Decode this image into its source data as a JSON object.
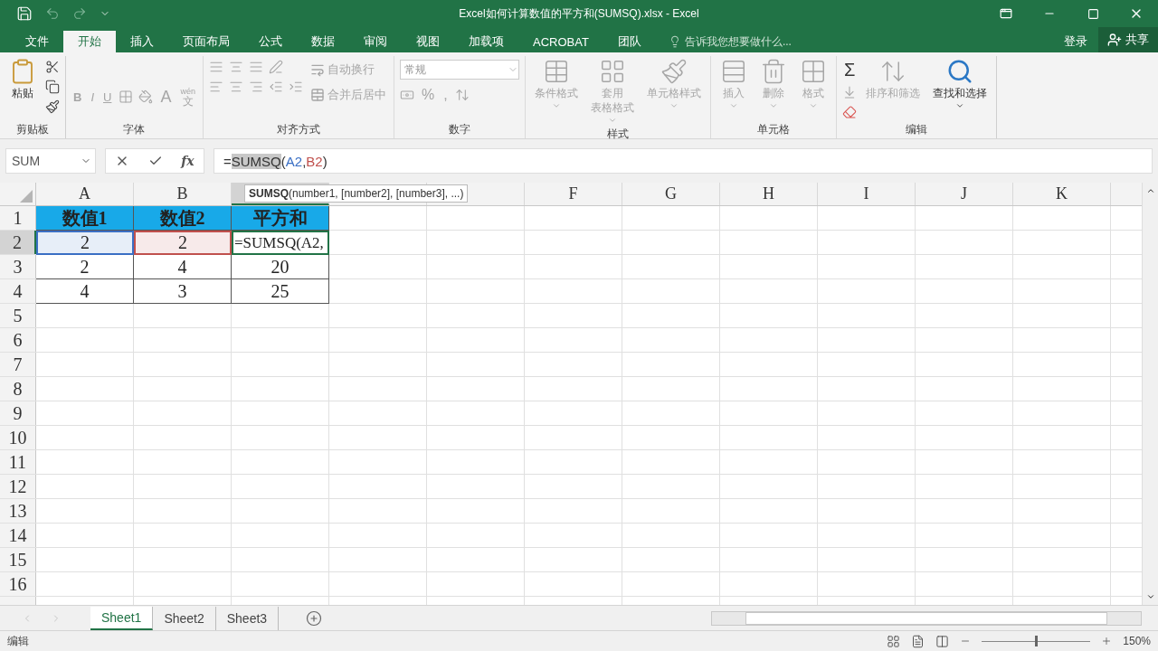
{
  "window": {
    "title": "Excel如何计算数值的平方和(SUMSQ).xlsx - Excel"
  },
  "tabs": [
    {
      "label": "文件",
      "selected": false
    },
    {
      "label": "开始",
      "selected": true
    },
    {
      "label": "插入",
      "selected": false
    },
    {
      "label": "页面布局",
      "selected": false
    },
    {
      "label": "公式",
      "selected": false
    },
    {
      "label": "数据",
      "selected": false
    },
    {
      "label": "审阅",
      "selected": false
    },
    {
      "label": "视图",
      "selected": false
    },
    {
      "label": "加载项",
      "selected": false
    },
    {
      "label": "ACROBAT",
      "selected": false
    },
    {
      "label": "团队",
      "selected": false
    }
  ],
  "tell_me": {
    "placeholder": "告诉我您想要做什么..."
  },
  "account": {
    "sign_in": "登录",
    "share": "共享"
  },
  "ribbon": {
    "groups": [
      {
        "kind": "clipboard",
        "label": "剪贴板",
        "disabled": false,
        "paste": "粘贴"
      },
      {
        "kind": "font",
        "label": "字体",
        "disabled": true,
        "buttons": [
          "B",
          "I",
          "U",
          "A"
        ],
        "phonetic": "wén",
        "phonetic_char": "文"
      },
      {
        "kind": "alignment",
        "label": "对齐方式",
        "disabled": true,
        "wrap": "自动换行",
        "merge": "合并后居中"
      },
      {
        "kind": "number",
        "label": "数字",
        "disabled": true,
        "format": "常规",
        "percent": "%",
        "comma": ","
      },
      {
        "kind": "large",
        "label": "样式",
        "disabled": true,
        "items": [
          {
            "lines": [
              "条件格式"
            ]
          },
          {
            "lines": [
              "套用",
              "表格格式"
            ]
          },
          {
            "lines": [
              "单元格样式"
            ]
          }
        ]
      },
      {
        "kind": "large",
        "label": "单元格",
        "disabled": true,
        "items": [
          {
            "lines": [
              "插入"
            ]
          },
          {
            "lines": [
              "删除"
            ]
          },
          {
            "lines": [
              "格式"
            ]
          }
        ]
      },
      {
        "kind": "editing",
        "label": "编辑",
        "disabled": false,
        "autosum": {
          "symbol": "Σ",
          "disabled": false
        },
        "sort": {
          "label": "排序和筛选",
          "disabled": true
        },
        "find": {
          "label": "查找和选择",
          "disabled": false
        }
      }
    ]
  },
  "formula_bar": {
    "name_box": "SUM",
    "fx": "fx",
    "tokens": [
      {
        "kind": "plain",
        "text": "="
      },
      {
        "kind": "function",
        "text": "SUMSQ"
      },
      {
        "kind": "plain",
        "text": "("
      },
      {
        "kind": "ref",
        "text": "A2",
        "color": "#3a6fc4"
      },
      {
        "kind": "plain",
        "text": ","
      },
      {
        "kind": "ref",
        "text": "B2",
        "color": "#c0504d"
      },
      {
        "kind": "plain",
        "text": ")"
      }
    ]
  },
  "tooltip": "**SUMSQ**(number1, [number2], [number3], ...)",
  "columns": [
    {
      "label": "A",
      "selected": false
    },
    {
      "label": "B",
      "selected": false
    },
    {
      "selected": true
    },
    {
      "selected": false
    },
    {
      "selected": false
    },
    {
      "label": "F",
      "selected": false
    },
    {
      "label": "G",
      "selected": false
    },
    {
      "label": "H",
      "selected": false
    },
    {
      "label": "I",
      "selected": false
    },
    {
      "label": "J",
      "selected": false
    },
    {
      "label": "K",
      "selected": false
    }
  ],
  "rows": [
    {
      "number": "1",
      "selected": false,
      "cells": [
        {
          "kind": "header",
          "text": "数值1"
        },
        {
          "kind": "header",
          "text": "数值2"
        },
        {
          "kind": "header",
          "text": "平方和"
        }
      ]
    },
    {
      "number": "2",
      "selected": true,
      "cells": [
        {
          "kind": "ref",
          "text": "2",
          "color": "#3a6fc4"
        },
        {
          "kind": "ref",
          "text": "2",
          "color": "#c0504d"
        },
        {
          "kind": "editing",
          "text": "=SUMSQ(A2,"
        }
      ]
    },
    {
      "number": "3",
      "selected": false,
      "cells": [
        {
          "kind": "value",
          "text": "2"
        },
        {
          "kind": "value",
          "text": "4"
        },
        {
          "kind": "value",
          "text": "20"
        }
      ]
    },
    {
      "number": "4",
      "selected": false,
      "cells": [
        {
          "kind": "value",
          "text": "4"
        },
        {
          "kind": "value",
          "text": "3"
        },
        {
          "kind": "value",
          "text": "25"
        }
      ]
    },
    {
      "number": "5",
      "selected": false
    },
    {
      "number": "6",
      "selected": false
    },
    {
      "number": "7",
      "selected": false
    },
    {
      "number": "8",
      "selected": false
    },
    {
      "number": "9",
      "selected": false
    },
    {
      "number": "10",
      "selected": false
    },
    {
      "number": "11",
      "selected": false
    },
    {
      "number": "12",
      "selected": false
    },
    {
      "number": "13",
      "selected": false
    },
    {
      "number": "14",
      "selected": false
    },
    {
      "number": "15",
      "selected": false
    },
    {
      "number": "16",
      "selected": false
    }
  ],
  "sheets": [
    {
      "label": "Sheet1",
      "selected": true
    },
    {
      "label": "Sheet2",
      "selected": false
    },
    {
      "label": "Sheet3",
      "selected": false
    }
  ],
  "status": {
    "mode": "编辑",
    "zoom": {
      "level": 0.5,
      "reading": "150%"
    }
  }
}
